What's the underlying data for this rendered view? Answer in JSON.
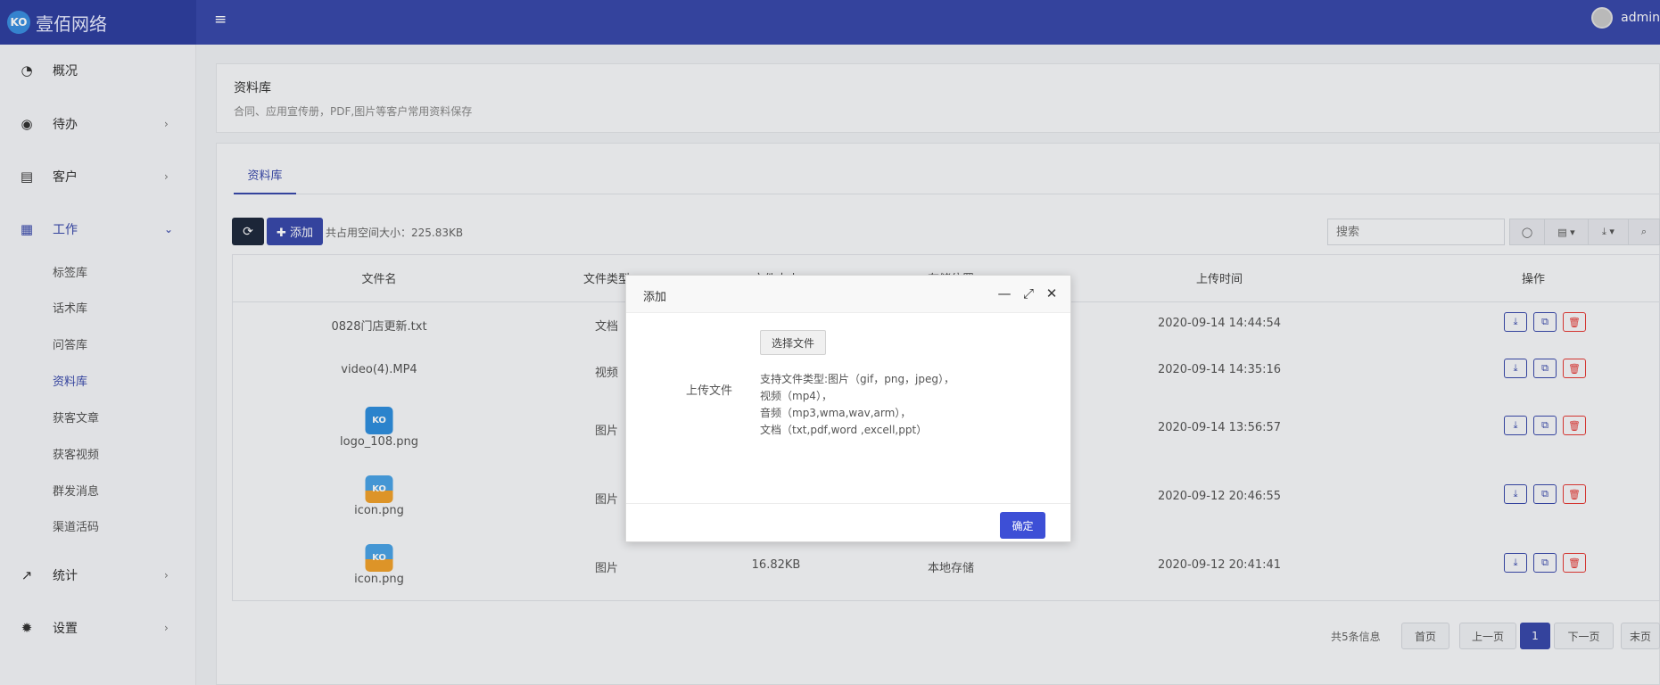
{
  "app": {
    "logo_mark": "KO",
    "logo_text": "壹佰网络",
    "menu_toggle": "≡",
    "user_name": "admin"
  },
  "sidebar": {
    "menu": [
      {
        "label": "概况",
        "icon": "dashboard-icon",
        "glyph": "◔"
      },
      {
        "label": "待办",
        "icon": "compass-icon",
        "glyph": "◉"
      },
      {
        "label": "客户",
        "icon": "id-card-icon",
        "glyph": "▤"
      },
      {
        "label": "工作",
        "icon": "grid-icon",
        "glyph": "▦"
      },
      {
        "label": "统计",
        "icon": "line-chart-icon",
        "glyph": "↗"
      },
      {
        "label": "设置",
        "icon": "gear-icon",
        "glyph": "✹"
      }
    ],
    "submenu": [
      "标签库",
      "话术库",
      "问答库",
      "资料库",
      "获客文章",
      "获客视频",
      "群发消息",
      "渠道活码"
    ],
    "arrow_right": "›",
    "arrow_down": "⌄"
  },
  "header_panel": {
    "title": "资料库",
    "desc": "合同、应用宣传册，PDF,图片等客户常用资料保存"
  },
  "tabs": [
    "资料库"
  ],
  "toolbar": {
    "refresh_glyph": "⟳",
    "add_label": "✚ 添加",
    "usage": "共占用空间大小：225.83KB",
    "search_placeholder": "搜索",
    "tool_glyphs": [
      "◯",
      "▤ ▾",
      "⤓ ▾",
      "⌕"
    ]
  },
  "table": {
    "headers": [
      "文件名",
      "文件类型",
      "文件大小",
      "存储位置",
      "上传时间",
      "操作"
    ],
    "rows": [
      {
        "name": "0828门店更新.txt",
        "type": "文档",
        "size": "",
        "storage": "",
        "time": "2020-09-14 14:44:54"
      },
      {
        "name": "video(4).MP4",
        "type": "视频",
        "size": "",
        "storage": "",
        "time": "2020-09-14 14:35:16"
      },
      {
        "name": "logo_108.png",
        "type": "图片",
        "size": "",
        "storage": "",
        "time": "2020-09-14 13:56:57"
      },
      {
        "name": "icon.png",
        "type": "图片",
        "size": "",
        "storage": "",
        "time": "2020-09-12 20:46:55"
      },
      {
        "name": "icon.png",
        "type": "图片",
        "size": "16.82KB",
        "storage": "本地存储",
        "time": "2020-09-12 20:41:41"
      }
    ],
    "op_glyphs": {
      "download": "⤓",
      "copy": "⧉",
      "delete": "🗑"
    }
  },
  "pagination": {
    "info": "共5条信息",
    "first": "首页",
    "prev": "上一页",
    "current": "1",
    "next": "下一页",
    "last": "末页"
  },
  "modal": {
    "title": "添加",
    "minimize": "—",
    "maximize": "⤢",
    "close": "✕",
    "upload_label": "上传文件",
    "choose_button": "选择文件",
    "hints": [
      "支持文件类型:图片（gif，png，jpeg），",
      "视频（mp4），",
      "音频（mp3,wma,wav,arm），",
      "文档（txt,pdf,word ,excell,ppt）"
    ],
    "ok_button": "确定"
  },
  "colors": {
    "primary": "#3949ab",
    "danger": "#e53935",
    "dark": "#1f2a3d"
  }
}
